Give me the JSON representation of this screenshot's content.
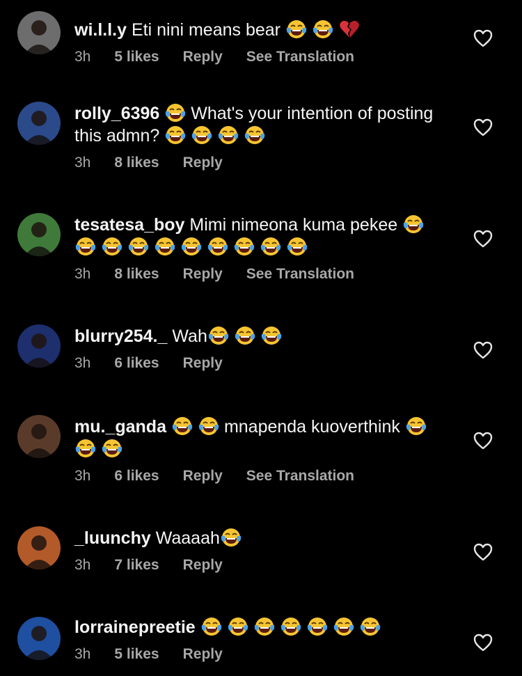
{
  "comments": [
    {
      "username": "wi.l.l.y",
      "text": "Eti nini means bear",
      "emojis": [
        "laughing-tears-emoji",
        "laughing-tears-emoji",
        "broken-heart-emoji"
      ],
      "time": "3h",
      "likes": "5 likes",
      "reply": "Reply",
      "translation": "See Translation",
      "avatar_color": "#6d6d6d"
    },
    {
      "username": "rolly_6396",
      "text": "What's your intention of posting this admn?",
      "emojis_before": [
        "laughing-tears-emoji"
      ],
      "emojis": [
        "laughing-tears-emoji",
        "laughing-tears-emoji",
        "laughing-tears-emoji",
        "laughing-tears-emoji"
      ],
      "time": "3h",
      "likes": "8 likes",
      "reply": "Reply",
      "avatar_color": "#2b4a8a"
    },
    {
      "username": "tesatesa_boy",
      "text": "Mimi nimeona kuma pekee",
      "emojis": [
        "laughing-tears-emoji",
        "laughing-tears-emoji",
        "laughing-tears-emoji",
        "laughing-tears-emoji",
        "laughing-tears-emoji",
        "laughing-tears-emoji",
        "laughing-tears-emoji",
        "laughing-tears-emoji",
        "laughing-tears-emoji",
        "laughing-tears-emoji"
      ],
      "time": "3h",
      "likes": "8 likes",
      "reply": "Reply",
      "translation": "See Translation",
      "avatar_color": "#3f7a3a"
    },
    {
      "username": "blurry254._",
      "text": "Wah",
      "emojis": [
        "laughing-tears-emoji",
        "laughing-tears-emoji",
        "laughing-tears-emoji"
      ],
      "time": "3h",
      "likes": "6 likes",
      "reply": "Reply",
      "avatar_color": "#1e2f6e"
    },
    {
      "username": "mu._ganda",
      "text": "mnapenda kuoverthink",
      "emojis_before": [
        "laughing-tears-emoji",
        "laughing-tears-emoji"
      ],
      "emojis": [
        "laughing-tears-emoji",
        "laughing-tears-emoji",
        "laughing-tears-emoji"
      ],
      "time": "3h",
      "likes": "6 likes",
      "reply": "Reply",
      "translation": "See Translation",
      "avatar_color": "#5a3b2a"
    },
    {
      "username": "_luunchy",
      "text": "Waaaah",
      "emojis": [
        "laughing-tears-emoji"
      ],
      "time": "3h",
      "likes": "7 likes",
      "reply": "Reply",
      "avatar_color": "#b35a2a"
    },
    {
      "username": "lorrainepreetie",
      "text": "",
      "emojis": [
        "laughing-tears-emoji",
        "laughing-tears-emoji",
        "laughing-tears-emoji",
        "laughing-tears-emoji",
        "laughing-tears-emoji",
        "laughing-tears-emoji",
        "laughing-tears-emoji"
      ],
      "time": "3h",
      "likes": "5 likes",
      "reply": "Reply",
      "avatar_color": "#1f4fa0"
    }
  ],
  "colors": {
    "background": "#000000",
    "text": "#f5f5f5",
    "meta": "#a8a8a8",
    "emoji_face": "#f7c531",
    "emoji_tears": "#4aa3e6"
  }
}
